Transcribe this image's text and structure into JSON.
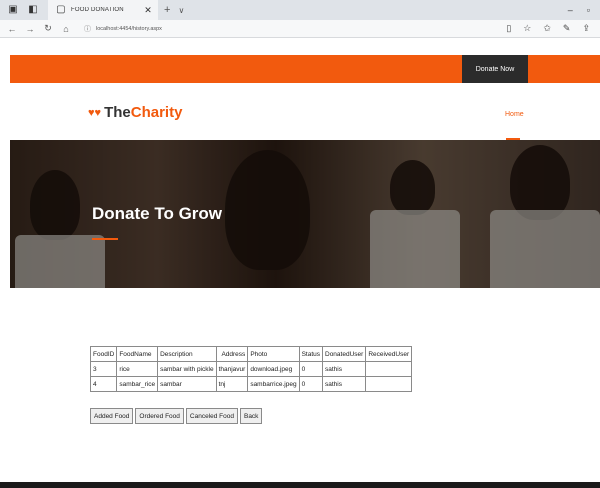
{
  "browser": {
    "tab_title": "FOOD DONATION",
    "url": "localhost:4454/history.aspx"
  },
  "site": {
    "donate_button": "Donate Now",
    "logo_the": "The",
    "logo_charity": "Charity",
    "nav_home": "Home",
    "hero_title": "Donate To Grow",
    "accent_color": "#f25a0e"
  },
  "table": {
    "headers": [
      "FoodID",
      "FoodName",
      "Description",
      "Address",
      "Photo",
      "Status",
      "DonatedUser",
      "ReceivedUser"
    ],
    "rows": [
      [
        "3",
        "rice",
        "sambar with pickle",
        "thanjavur",
        "download.jpeg",
        "0",
        "sathis",
        ""
      ],
      [
        "4",
        "sambar_rice",
        "sambar",
        "tnj",
        "sambarrice.jpeg",
        "0",
        "sathis",
        ""
      ]
    ]
  },
  "buttons": {
    "added": "Added Food",
    "ordered": "Ordered Food",
    "canceled": "Canceled Food",
    "back": "Back"
  }
}
